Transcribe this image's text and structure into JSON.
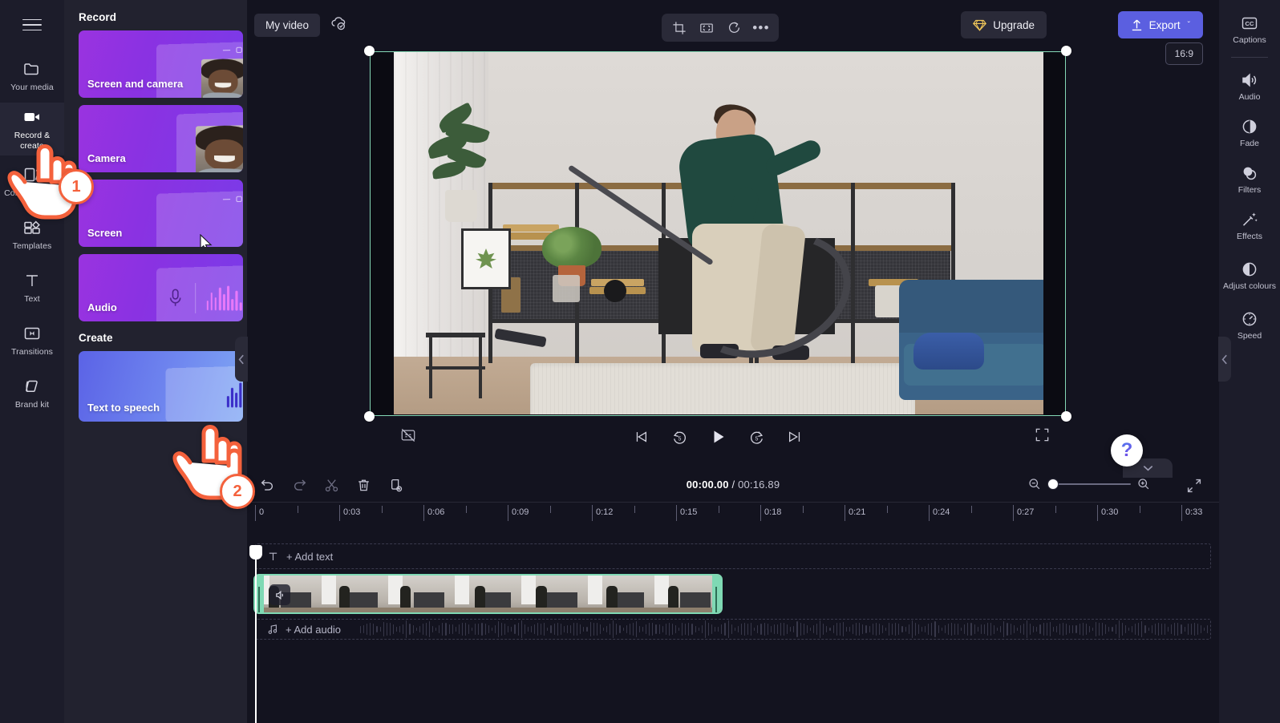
{
  "left_rail": {
    "menu_icon": "hamburger-menu-icon",
    "items": [
      {
        "label": "Your media",
        "icon": "folder-icon",
        "active": false
      },
      {
        "label": "Record & create",
        "icon": "video-camera-icon",
        "active": true
      },
      {
        "label": "Content library",
        "icon": "content-library-icon",
        "active": false
      },
      {
        "label": "Templates",
        "icon": "templates-grid-icon",
        "active": false
      },
      {
        "label": "Text",
        "icon": "text-t-icon",
        "active": false
      },
      {
        "label": "Transitions",
        "icon": "transitions-icon",
        "active": false
      },
      {
        "label": "Brand kit",
        "icon": "brand-kit-icon",
        "active": false
      }
    ]
  },
  "panel": {
    "record_heading": "Record",
    "create_heading": "Create",
    "record_cards": [
      {
        "label": "Screen and camera",
        "art": "screen-with-person"
      },
      {
        "label": "Camera",
        "art": "person-portrait"
      },
      {
        "label": "Screen",
        "art": "screen-cursor"
      },
      {
        "label": "Audio",
        "art": "microphone-waveform"
      }
    ],
    "create_cards": [
      {
        "label": "Text to speech",
        "art": "text-to-speech-waveform"
      }
    ],
    "collapse_icon": "chevron-left-icon"
  },
  "topbar": {
    "video_title": "My video",
    "save_state_icon": "cloud-saved-icon",
    "tools": [
      {
        "name": "crop-icon",
        "label": "Crop"
      },
      {
        "name": "fit-icon",
        "label": "Fit"
      },
      {
        "name": "rotate-icon",
        "label": "Rotate"
      },
      {
        "name": "more-options-icon",
        "label": "More"
      }
    ],
    "upgrade_label": "Upgrade",
    "upgrade_icon": "diamond-icon",
    "export_label": "Export",
    "export_icon": "upload-arrow-icon",
    "export_chevron": "ˇ"
  },
  "preview": {
    "aspect_ratio": "16:9",
    "scene_description": "Man vacuuming a living room rug",
    "selected": true
  },
  "player": {
    "captions_toggle_icon": "captions-off-icon",
    "controls": [
      {
        "name": "skip-to-start-button",
        "icon": "skip-previous-icon"
      },
      {
        "name": "rewind-5s-button",
        "icon": "replay-5-icon"
      },
      {
        "name": "play-button",
        "icon": "play-icon"
      },
      {
        "name": "forward-5s-button",
        "icon": "forward-5-icon"
      },
      {
        "name": "skip-to-end-button",
        "icon": "skip-next-icon"
      }
    ],
    "fullscreen_icon": "fullscreen-icon"
  },
  "help": {
    "label": "?",
    "chevron_down": "ˇ"
  },
  "timeline": {
    "tools": [
      {
        "name": "undo-button",
        "icon": "undo-icon"
      },
      {
        "name": "redo-button",
        "icon": "redo-icon"
      },
      {
        "name": "split-button",
        "icon": "scissors-icon"
      },
      {
        "name": "delete-button",
        "icon": "trash-icon"
      },
      {
        "name": "duplicate-button",
        "icon": "duplicate-icon"
      }
    ],
    "current_time": "00:00.00",
    "separator": "/",
    "total_time": "00:16.89",
    "zoom_out_icon": "zoom-out-icon",
    "zoom_in_icon": "zoom-in-icon",
    "zoom_value": 0,
    "expand_icon": "fit-timeline-icon",
    "ruler_labels": [
      "0",
      "0:03",
      "0:06",
      "0:09",
      "0:12",
      "0:15",
      "0:18",
      "0:21",
      "0:24",
      "0:27",
      "0:30",
      "0:33"
    ],
    "add_text_label": "+ Add text",
    "add_text_icon": "text-t-icon",
    "add_audio_label": "+ Add audio",
    "add_audio_icon": "music-note-icon",
    "clip": {
      "name": "video-clip",
      "audio_icon": "volume-icon",
      "selected": true
    },
    "playhead_position": "0"
  },
  "right_rail": {
    "items": [
      {
        "label": "Captions",
        "icon": "closed-captions-icon",
        "separator_after": true
      },
      {
        "label": "Audio",
        "icon": "speaker-icon",
        "separator_after": false
      },
      {
        "label": "Fade",
        "icon": "fade-icon",
        "separator_after": false
      },
      {
        "label": "Filters",
        "icon": "filters-icon",
        "separator_after": false
      },
      {
        "label": "Effects",
        "icon": "magic-wand-icon",
        "separator_after": false
      },
      {
        "label": "Adjust colours",
        "icon": "contrast-icon",
        "separator_after": false
      },
      {
        "label": "Speed",
        "icon": "speedometer-icon",
        "separator_after": false
      }
    ],
    "collapse_icon": "chevron-left-icon"
  },
  "callouts": [
    {
      "number": "1",
      "target": "record-and-create-rail-item"
    },
    {
      "number": "2",
      "target": "text-to-speech-card"
    }
  ],
  "colors": {
    "accent_purple": "#5b5fe0",
    "card_purple": "#8a32e2",
    "card_blue": "#6f86ef",
    "clip_selected": "#7fd9b4",
    "callout_orange": "#f4613c",
    "bg_dark": "#13131f",
    "panel_bg": "#22222f",
    "rail_bg": "#1c1c2a"
  }
}
